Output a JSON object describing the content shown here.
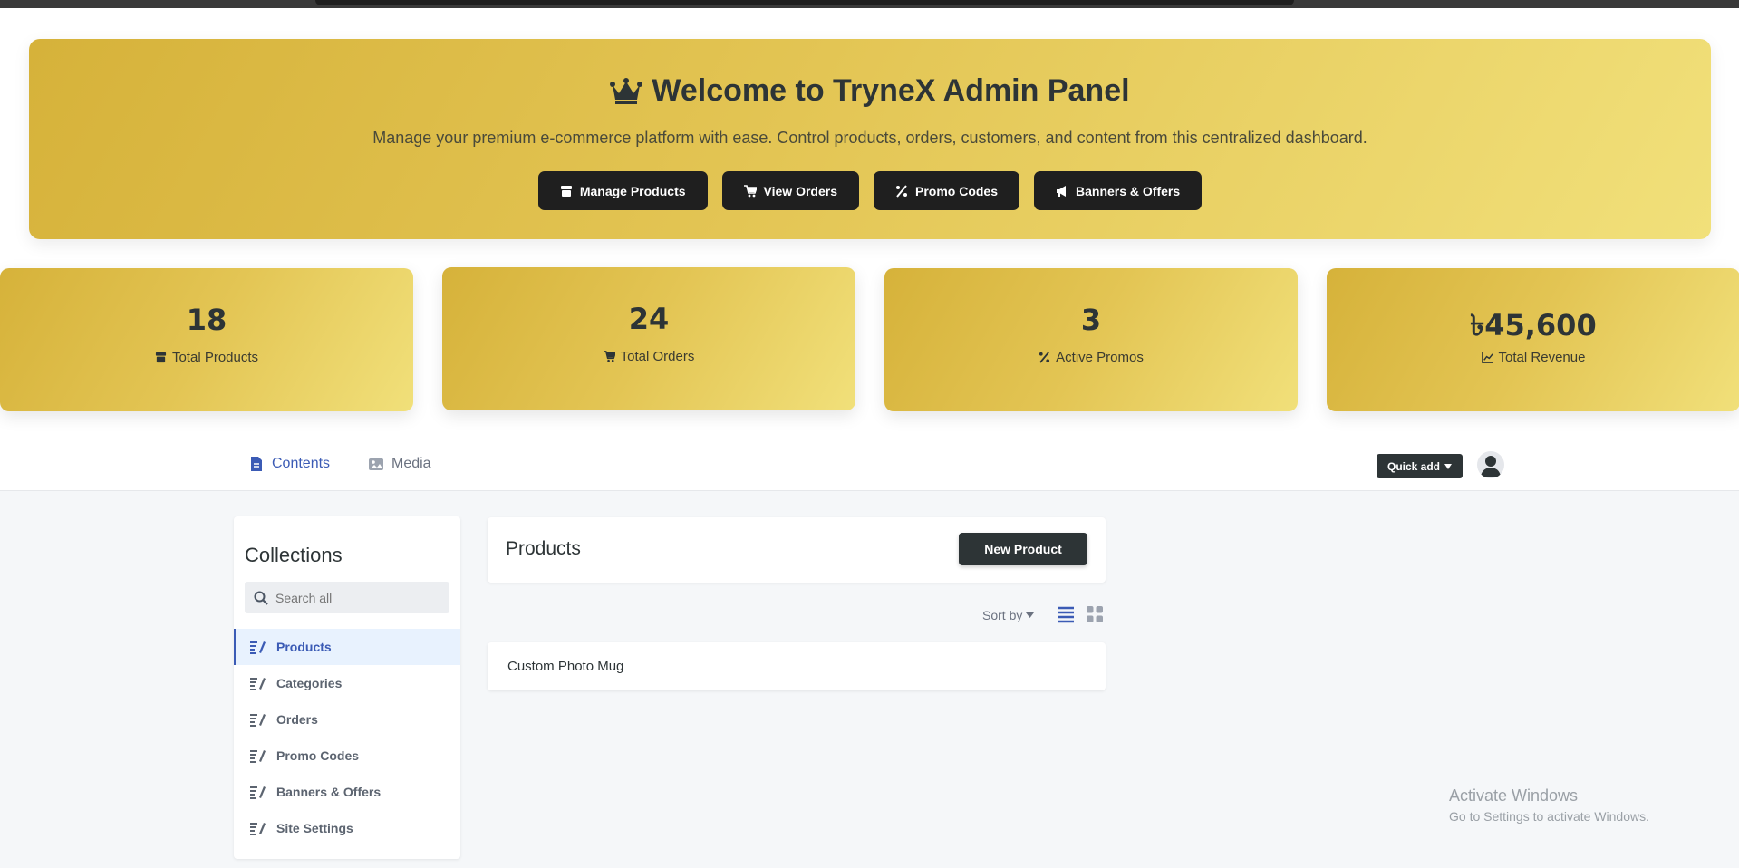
{
  "hero": {
    "title": "Welcome to TryneX Admin Panel",
    "subtitle": "Manage your premium e-commerce platform with ease. Control products, orders, customers, and content from this centralized dashboard.",
    "buttons": [
      {
        "label": "Manage Products",
        "icon": "box-icon"
      },
      {
        "label": "View Orders",
        "icon": "cart-icon"
      },
      {
        "label": "Promo Codes",
        "icon": "percent-icon"
      },
      {
        "label": "Banners & Offers",
        "icon": "megaphone-icon"
      }
    ]
  },
  "stats": [
    {
      "value": "18",
      "label": "Total Products",
      "icon": "box-icon"
    },
    {
      "value": "24",
      "label": "Total Orders",
      "icon": "cart-icon"
    },
    {
      "value": "3",
      "label": "Active Promos",
      "icon": "percent-icon"
    },
    {
      "value": "৳45,600",
      "label": "Total Revenue",
      "icon": "chart-line-icon"
    }
  ],
  "nav": {
    "tabs": [
      {
        "label": "Contents",
        "icon": "file-icon",
        "active": true
      },
      {
        "label": "Media",
        "icon": "image-icon",
        "active": false
      }
    ],
    "quick_add": "Quick add"
  },
  "sidebar": {
    "title": "Collections",
    "search_placeholder": "Search all",
    "items": [
      {
        "label": "Products",
        "active": true
      },
      {
        "label": "Categories",
        "active": false
      },
      {
        "label": "Orders",
        "active": false
      },
      {
        "label": "Promo Codes",
        "active": false
      },
      {
        "label": "Banners & Offers",
        "active": false
      },
      {
        "label": "Site Settings",
        "active": false
      }
    ]
  },
  "main": {
    "title": "Products",
    "new_button": "New Product",
    "sort_label": "Sort by",
    "rows": [
      "Custom Photo Mug"
    ]
  },
  "watermark": {
    "line1": "Activate Windows",
    "line2": "Go to Settings to activate Windows."
  },
  "colors": {
    "accent": "#3b5bb5",
    "gold": "#e3c554",
    "dark": "#2d3436"
  }
}
